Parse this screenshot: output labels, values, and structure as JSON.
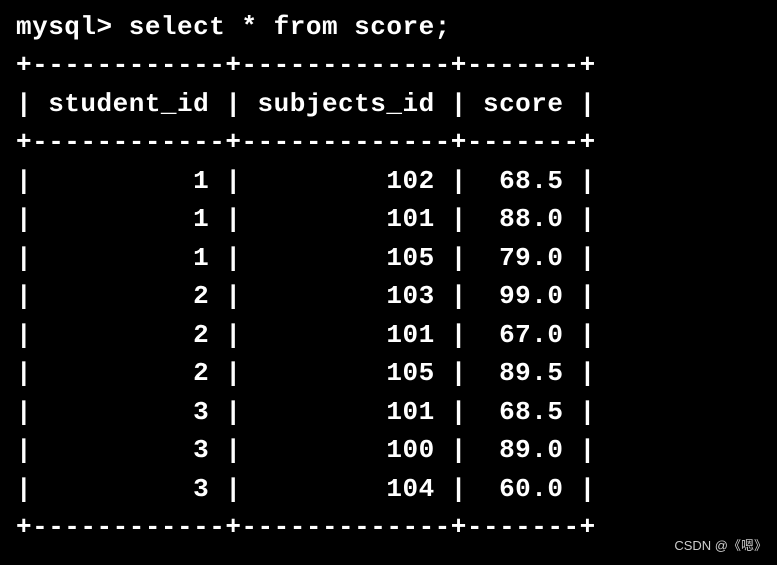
{
  "prompt": "mysql> ",
  "query": "select * from score;",
  "border_top": "+------------+-------------+-------+",
  "header_line": "| student_id | subjects_id | score |",
  "border_mid": "+------------+-------------+-------+",
  "chart_data": {
    "type": "table",
    "columns": [
      "student_id",
      "subjects_id",
      "score"
    ],
    "rows": [
      {
        "student_id": 1,
        "subjects_id": 102,
        "score": "68.5"
      },
      {
        "student_id": 1,
        "subjects_id": 101,
        "score": "88.0"
      },
      {
        "student_id": 1,
        "subjects_id": 105,
        "score": "79.0"
      },
      {
        "student_id": 2,
        "subjects_id": 103,
        "score": "99.0"
      },
      {
        "student_id": 2,
        "subjects_id": 101,
        "score": "67.0"
      },
      {
        "student_id": 2,
        "subjects_id": 105,
        "score": "89.5"
      },
      {
        "student_id": 3,
        "subjects_id": 101,
        "score": "68.5"
      },
      {
        "student_id": 3,
        "subjects_id": 100,
        "score": "89.0"
      },
      {
        "student_id": 3,
        "subjects_id": 104,
        "score": "60.0"
      }
    ]
  },
  "row_lines": [
    "|          1 |         102 |  68.5 |",
    "|          1 |         101 |  88.0 |",
    "|          1 |         105 |  79.0 |",
    "|          2 |         103 |  99.0 |",
    "|          2 |         101 |  67.0 |",
    "|          2 |         105 |  89.5 |",
    "|          3 |         101 |  68.5 |",
    "|          3 |         100 |  89.0 |",
    "|          3 |         104 |  60.0 |"
  ],
  "border_bot": "+------------+-------------+-------+",
  "watermark": "CSDN @《嗯》"
}
